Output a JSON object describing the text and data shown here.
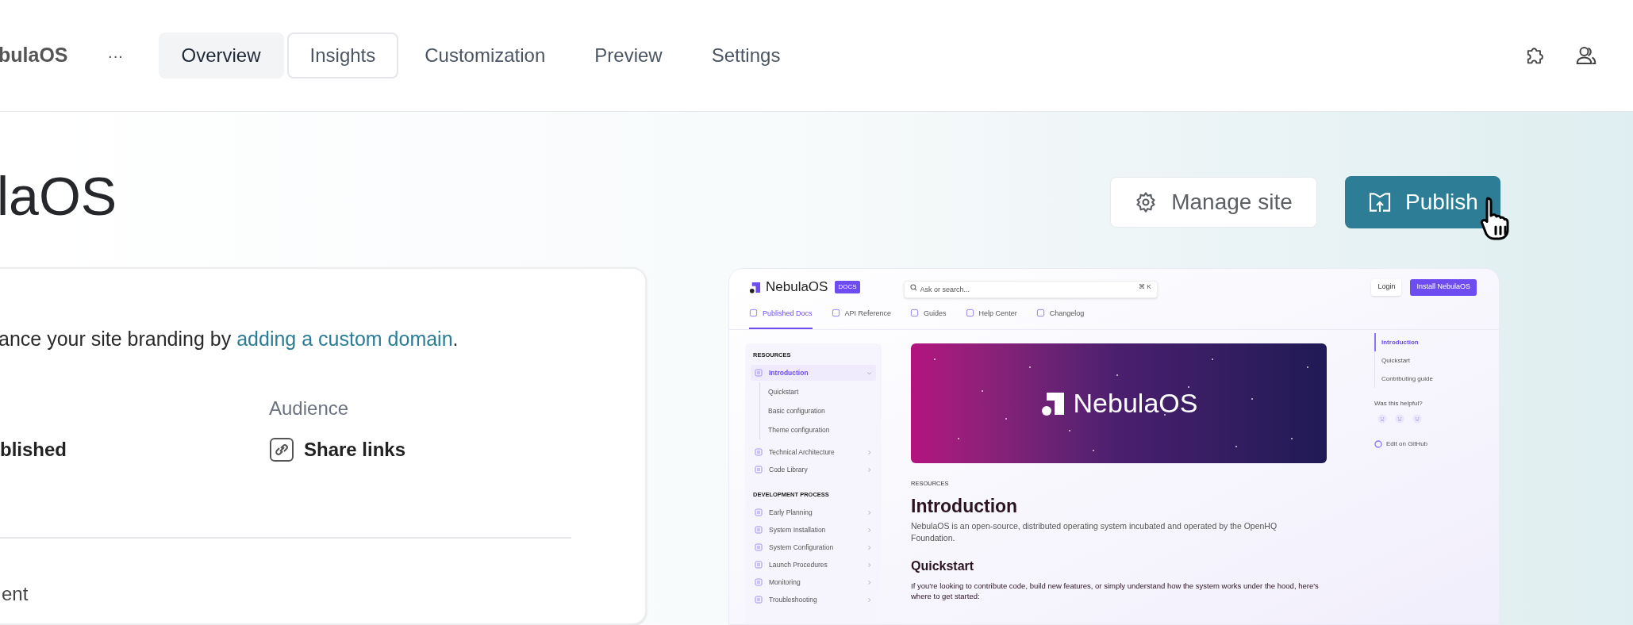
{
  "app": {
    "name": "bulaOS",
    "more": "···"
  },
  "tabs": [
    {
      "label": "Overview",
      "selected": true,
      "focused": false
    },
    {
      "label": "Insights",
      "selected": false,
      "focused": true
    },
    {
      "label": "Customization",
      "selected": false,
      "focused": false
    },
    {
      "label": "Preview",
      "selected": false,
      "focused": false
    },
    {
      "label": "Settings",
      "selected": false,
      "focused": false
    }
  ],
  "page_title": "laOS",
  "actions": [
    {
      "kind": "secondary",
      "label": "Manage site"
    },
    {
      "kind": "primary",
      "label": "Publish"
    }
  ],
  "card": {
    "note": "ance your site branding by ",
    "link": "adding a custom domain",
    "note_end": ".",
    "fields": [
      {
        "value": "blished"
      },
      {
        "label": "Audience",
        "value": "Share links"
      }
    ],
    "footer": "ent"
  },
  "preview": {
    "brand": "NebulaOS",
    "badge": "DOCS",
    "search": {
      "placeholder": "Ask or search...",
      "shortcut": "⌘ K"
    },
    "header_buttons": [
      {
        "kind": "secondary",
        "label": "Login"
      },
      {
        "kind": "primary",
        "label": "Install NebulaOS"
      }
    ],
    "nav": [
      {
        "label": "Published Docs",
        "selected": true
      },
      {
        "label": "API Reference",
        "selected": false
      },
      {
        "label": "Guides",
        "selected": false
      },
      {
        "label": "Help Center",
        "selected": false
      },
      {
        "label": "Changelog",
        "selected": false
      }
    ],
    "sidebar": [
      {
        "heading": "RESOURCES",
        "items": [
          {
            "label": "Introduction",
            "selected": true,
            "expanded": true,
            "children": [
              {
                "label": "Quickstart"
              },
              {
                "label": "Basic configuration"
              },
              {
                "label": "Theme configuration"
              }
            ]
          },
          {
            "label": "Technical Architecture",
            "selected": false,
            "expanded": false
          },
          {
            "label": "Code Library",
            "selected": false,
            "expanded": false
          }
        ]
      },
      {
        "heading": "DEVELOPMENT PROCESS",
        "items": [
          {
            "label": "Early Planning",
            "selected": false,
            "expanded": false
          },
          {
            "label": "System Installation",
            "selected": false,
            "expanded": false
          },
          {
            "label": "System Configuration",
            "selected": false,
            "expanded": false
          },
          {
            "label": "Launch Procedures",
            "selected": false,
            "expanded": false
          },
          {
            "label": "Monitoring",
            "selected": false,
            "expanded": false
          },
          {
            "label": "Troubleshooting",
            "selected": false,
            "expanded": false
          }
        ]
      }
    ],
    "banner": {
      "title": "NebulaOS"
    },
    "article": {
      "eyebrow": "RESOURCES",
      "title": "Introduction",
      "intro": "NebulaOS is an open-source, distributed operating system incubated and operated by the OpenHQ Foundation.",
      "sections": [
        {
          "heading": "Quickstart",
          "text": "If you're looking to contribute code, build new features, or simply understand how the system works under the hood, here's where to get started:"
        }
      ]
    },
    "toc": [
      {
        "label": "Introduction",
        "selected": true
      },
      {
        "label": "Quickstart",
        "selected": false
      },
      {
        "label": "Contributing guide",
        "selected": false
      }
    ],
    "feedback": {
      "question": "Was this helpful?"
    },
    "edit_link": "Edit on GitHub"
  }
}
